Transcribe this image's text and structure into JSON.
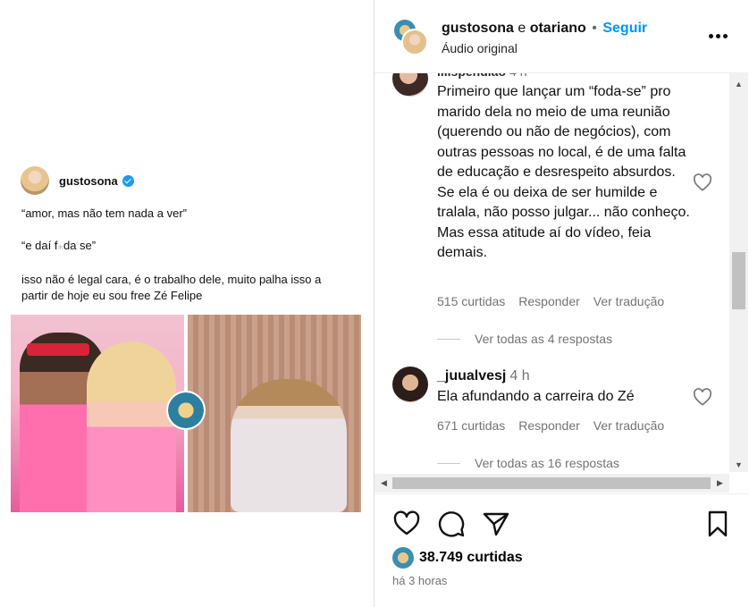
{
  "post": {
    "user": "gustosona",
    "lines": [
      "“amor, mas não tem nada a ver”",
      "“e daí f",
      "da se”",
      "isso não é legal cara, é o trabalho dele, muito palha isso a",
      "partir de hoje eu sou free Zé Felipe"
    ],
    "icons": {
      "verified": "verified-badge-icon"
    }
  },
  "header": {
    "user1": "gustosona",
    "conj": "e",
    "user2": "otariano",
    "dot": "•",
    "follow": "Seguir",
    "audio": "Áudio original"
  },
  "comments": [
    {
      "user": "lilispendiao",
      "time": "4 h",
      "text": "Primeiro que lançar um “foda-se” pro marido dela no meio de uma reunião (querendo ou não de negócios), com outras pessoas no local, é de uma falta de educação e desrespeito absurdos. Se ela é ou deixa de ser humilde e tralala, não posso julgar... não conheço. Mas essa atitude aí do vídeo, feia demais.",
      "likes": "515 curtidas",
      "reply": "Responder",
      "translate": "Ver tradução",
      "replies": "Ver todas as 4 respostas"
    },
    {
      "user": "_juualvesj",
      "time": "4 h",
      "text": "Ela afundando a carreira do Zé",
      "likes": "671 curtidas",
      "reply": "Responder",
      "translate": "Ver tradução",
      "replies": "Ver todas as 16 respostas"
    }
  ],
  "footer": {
    "likes_count": "38.749 curtidas",
    "time_ago": "há 3 horas"
  },
  "colors": {
    "accent": "#0095f6",
    "muted": "#737373",
    "text": "#111111"
  }
}
